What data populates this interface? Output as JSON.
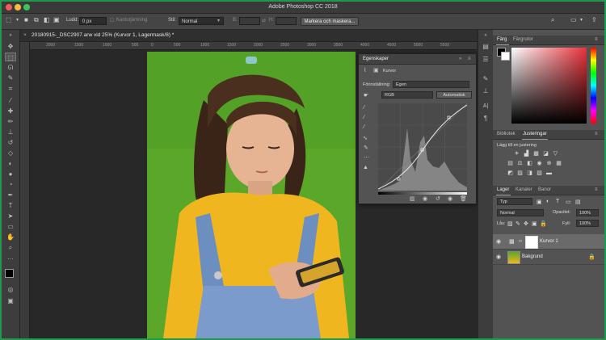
{
  "window": {
    "title": "Adobe Photoshop CC 2018"
  },
  "options_bar": {
    "feather_label": "Ludd:",
    "feather_value": "0 px",
    "antialias_label": "Kantutjämning",
    "style_label": "Stil:",
    "style_value": "Normal",
    "width_label": "B:",
    "height_label": "H:",
    "select_mask_button": "Markera och maskera..."
  },
  "document": {
    "tab_title": "20180915-_DSC2907.arw vid 25% (Kurvor 1, Lagermask/8) *",
    "ruler_labels": [
      "2000",
      "1500",
      "1000",
      "500",
      "0",
      "500",
      "1000",
      "1500",
      "2000",
      "2500",
      "3000",
      "3500",
      "4000",
      "4500",
      "5000",
      "5500"
    ]
  },
  "properties_panel": {
    "tab": "Egenskaper",
    "adjustment_name": "Kurvor",
    "preset_label": "Förinställning:",
    "preset_value": "Egen",
    "channel_value": "RGB",
    "auto_button": "Automatisk"
  },
  "color_panel": {
    "tabs": [
      "Färg",
      "Färgrutor"
    ],
    "active_tab": "Färg",
    "accent_color": "#e8323a"
  },
  "adjustments_panel": {
    "tabs": [
      "Bibliotek",
      "Justeringar"
    ],
    "active_tab": "Justeringar",
    "add_label": "Lägg till en justering"
  },
  "layers_panel": {
    "tabs": [
      "Lager",
      "Kanaler",
      "Banor"
    ],
    "active_tab": "Lager",
    "filter_value": "Typ",
    "blend_mode": "Normal",
    "opacity_label": "Opacitet:",
    "opacity_value": "100%",
    "lock_label": "Lås:",
    "fill_label": "Fyll:",
    "fill_value": "100%",
    "layers": [
      {
        "name": "Kurvor 1",
        "visible": true,
        "type": "adjustment"
      },
      {
        "name": "Bakgrund",
        "visible": true,
        "type": "background"
      }
    ]
  }
}
